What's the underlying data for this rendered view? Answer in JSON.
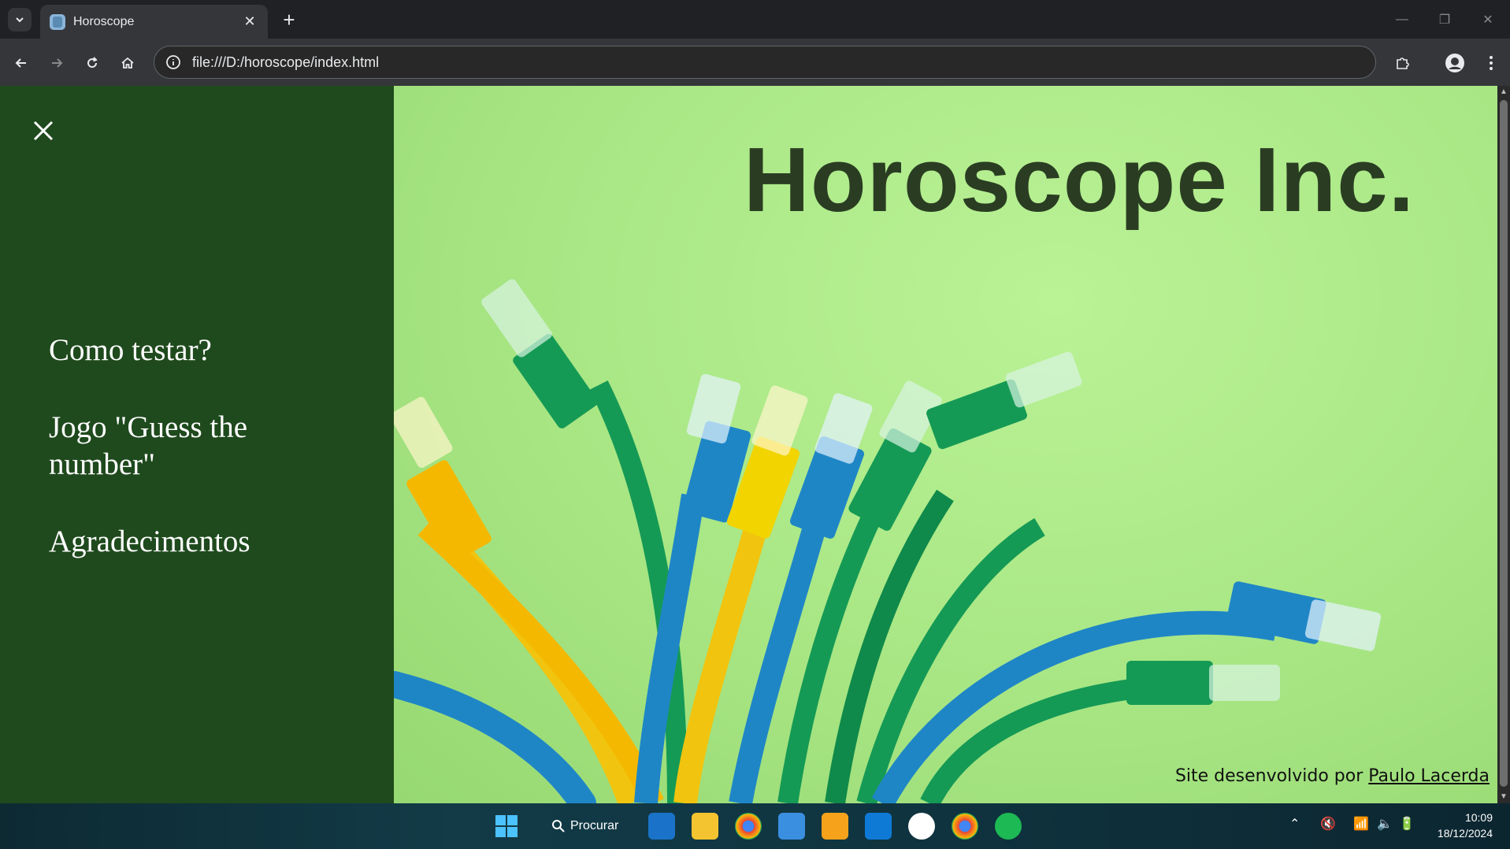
{
  "browser": {
    "tab_title": "Horoscope",
    "url": "file:///D:/horoscope/index.html"
  },
  "sidebar": {
    "items": [
      {
        "label": "Como testar?"
      },
      {
        "label": "Jogo \"Guess the number\""
      },
      {
        "label": "Agradecimentos"
      }
    ]
  },
  "hero": {
    "title": "Horoscope Inc.",
    "credit_prefix": "Site desenvolvido por",
    "credit_link": "Paulo Lacerda"
  },
  "taskbar": {
    "search_label": "Procurar",
    "time": "10:09",
    "date": "18/12/2024"
  },
  "colors": {
    "sidebar_bg": "#1f4a1d",
    "hero_bg": "#b4ee8e",
    "title_color": "#2a3d22"
  }
}
